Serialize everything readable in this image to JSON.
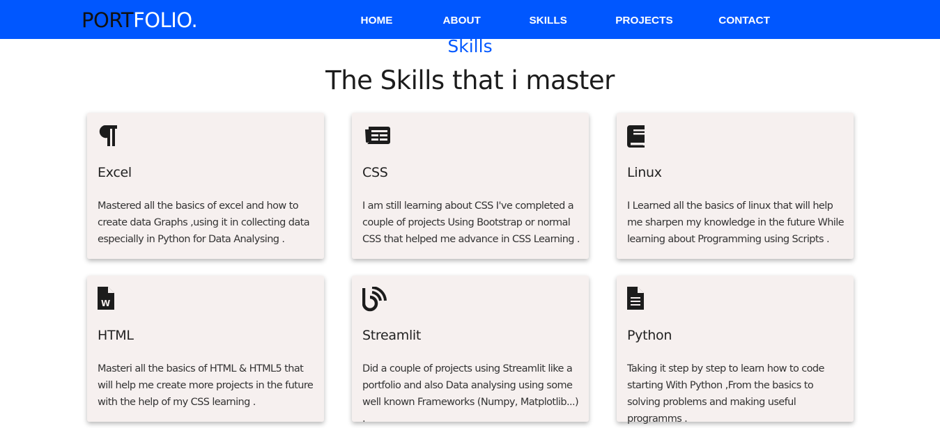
{
  "nav": {
    "logo_part1": "PORT",
    "logo_part2": "FOLIO.",
    "links": [
      "HOME",
      "ABOUT",
      "SKILLS",
      "PROJECTS",
      "CONTACT"
    ]
  },
  "section": {
    "subtitle": "Skills",
    "title": "The Skills that i master"
  },
  "cards": [
    {
      "icon": "paragraph-icon",
      "name": "Excel",
      "desc": "Mastered all the basics of excel and how to create data Graphs ,using it in collecting data especially in Python for Data Analysing ."
    },
    {
      "icon": "newspaper-icon",
      "name": "CSS",
      "desc": "I am still learning about CSS I've completed a couple of projects Using Bootstrap or normal CSS that helped me advance in CSS Learning ."
    },
    {
      "icon": "book-icon",
      "name": "Linux",
      "desc": "I Learned all the basics of linux that will help me sharpen my knowledge in the future While learning about Programming using Scripts ."
    },
    {
      "icon": "word-file-icon",
      "name": "HTML",
      "desc": "Masteri all the basics of HTML & HTML5 that will help me create more projects in the future with the help of my CSS learning ."
    },
    {
      "icon": "blog-icon",
      "name": "Streamlit",
      "desc": "Did a couple of projects using Streamlit like a portfolio and also Data analysing using some well known Frameworks (Numpy, Matplotlib...) ."
    },
    {
      "icon": "file-text-icon",
      "name": "Python",
      "desc": "Taking it step by step to learn how to code starting With Python ,From the basics to solving problems and making useful programms ."
    }
  ],
  "colors": {
    "accent": "#0057ff",
    "card_bg": "#f6f0ef",
    "text_dark": "#1c1c1c"
  }
}
